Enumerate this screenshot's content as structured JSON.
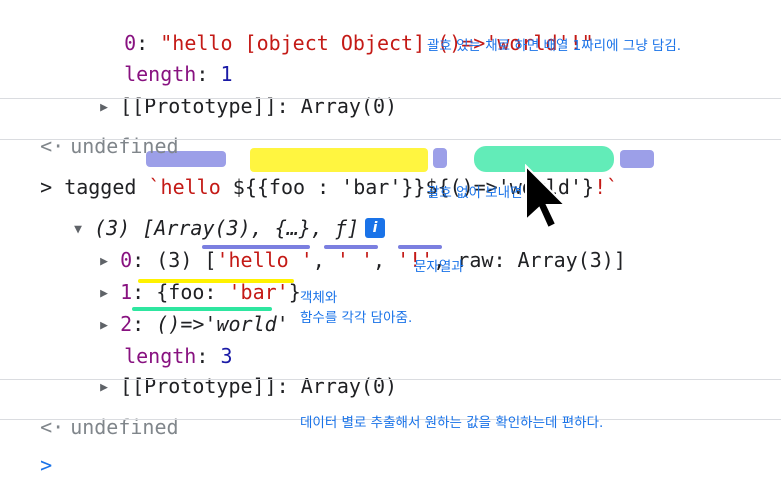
{
  "console": {
    "top_array": {
      "item0_key": "0",
      "item0_value": "\"hello [object Object] ()=>'world'!\"",
      "length_key": "length",
      "length_value": "1",
      "prototype_label": "[[Prototype]]",
      "prototype_value": "Array(0)"
    },
    "undefined_1": "undefined",
    "input_line": {
      "prefix": "tagged ",
      "t1": "`hello ",
      "t2": "${",
      "t3": "{foo : 'bar'}",
      "t4": "}",
      "t5": "${",
      "t6": "()=>'world'",
      "t7": "}",
      "t8": "!`"
    },
    "result": {
      "summary": "(3) [Array(3), {…}, ƒ]",
      "info_label": "i",
      "item0_key": "0",
      "item0_prefix": "(3) [",
      "item0_s1": "'hello '",
      "item0_comma1": ", ",
      "item0_s2": "' '",
      "item0_comma2": ", ",
      "item0_s3": "'!'",
      "item0_raw_key": ", raw",
      "item0_raw_value": ": Array(3)]",
      "item1_key": "1",
      "item1_open": "{foo: ",
      "item1_val": "'bar'",
      "item1_close": "}",
      "item2_key": "2",
      "item2_value": "()=>'world'",
      "length_key": "length",
      "length_value": "3",
      "prototype_label": "[[Prototype]]",
      "prototype_value": "Array(0)"
    },
    "undefined_2": "undefined"
  },
  "annotations": {
    "note1": "괄호 있는 채로 하면 배열 1짜리에 그냥 담김.",
    "note2": "괄호 없이 보내면",
    "note3": "문자열과",
    "note4_line1": "객체와",
    "note4_line2": "함수를 각각 담아줌.",
    "note5": "데이터 별로 추출해서 원하는 값을 확인하는데 편하다."
  },
  "colors": {
    "highlight_blue": "#7b7fe0",
    "highlight_yellow": "#fff200",
    "highlight_green": "#2ee6a0",
    "note_text": "#1a73e8"
  }
}
